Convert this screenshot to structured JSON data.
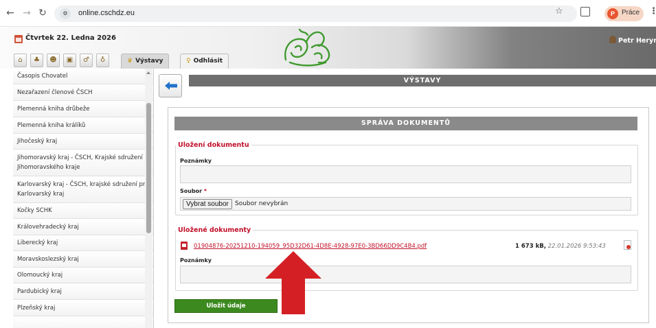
{
  "browser": {
    "url": "online.cschdz.eu",
    "profile_initial": "P",
    "profile_name": "Práce"
  },
  "header": {
    "date": "Čtvrtek 22. Ledna 2026",
    "user_name": "Petr Heryne",
    "tabs": [
      {
        "label": "Výstavy",
        "active": true
      },
      {
        "label": "Odhlásit",
        "active": false
      }
    ]
  },
  "sidebar": {
    "items": [
      "Časopis Chovatel",
      "Nezařazení členové ČSCH",
      "Plemenná kniha drůbeže",
      "Plemenná kniha králíků",
      "Jihočeský kraj",
      "Jihomoravský kraj - ČSCH, Krajské sdružení Jihomoravského kraje",
      "Karlovarský kraj - ČSCH, krajské sdružení pro Karlovarský kraj",
      "Kočky SCHK",
      "Královehradecký kraj",
      "Liberecký kraj",
      "Moravskoslezský kraj",
      "Olomoucký kraj",
      "Pardubický kraj",
      "Plzeňský kraj"
    ]
  },
  "main": {
    "section_title": "VÝSTAVY",
    "panel_title": "SPRÁVA DOKUMENTŮ",
    "upload": {
      "legend": "Uložení dokumentu",
      "notes_label": "Poznámky",
      "file_label": "Soubor",
      "required_mark": "*",
      "file_button": "Vybrat soubor",
      "file_status": "Soubor nevybrán"
    },
    "saved": {
      "legend": "Uložené dokumenty",
      "file_name": "01904876-20251210-194059_95D32D61-4D8E-4928-97E0-3BD66DD9C4B4.pdf",
      "file_size": "1 673 kB,",
      "file_date": "22.01.2026 9:53:43",
      "notes_label": "Poznámky"
    },
    "save_button": "Uložit údaje"
  },
  "colors": {
    "accent_red": "#c0102a",
    "save_green": "#3c8a1f",
    "bar_grey": "#6e6e6e"
  }
}
